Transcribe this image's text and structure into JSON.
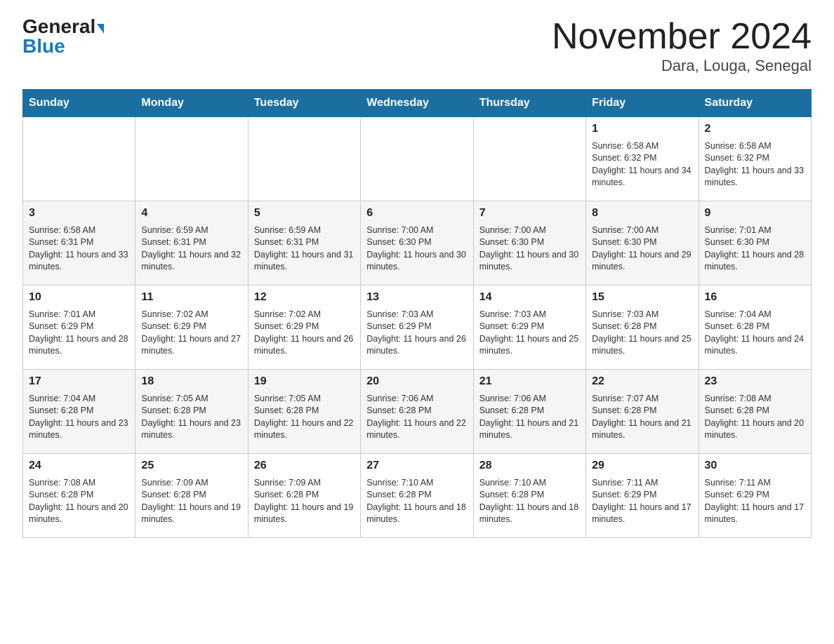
{
  "header": {
    "logo_general": "General",
    "logo_blue": "Blue",
    "title": "November 2024",
    "subtitle": "Dara, Louga, Senegal"
  },
  "weekdays": [
    "Sunday",
    "Monday",
    "Tuesday",
    "Wednesday",
    "Thursday",
    "Friday",
    "Saturday"
  ],
  "weeks": [
    {
      "days": [
        {
          "num": "",
          "sunrise": "",
          "sunset": "",
          "daylight": ""
        },
        {
          "num": "",
          "sunrise": "",
          "sunset": "",
          "daylight": ""
        },
        {
          "num": "",
          "sunrise": "",
          "sunset": "",
          "daylight": ""
        },
        {
          "num": "",
          "sunrise": "",
          "sunset": "",
          "daylight": ""
        },
        {
          "num": "",
          "sunrise": "",
          "sunset": "",
          "daylight": ""
        },
        {
          "num": "1",
          "sunrise": "Sunrise: 6:58 AM",
          "sunset": "Sunset: 6:32 PM",
          "daylight": "Daylight: 11 hours and 34 minutes."
        },
        {
          "num": "2",
          "sunrise": "Sunrise: 6:58 AM",
          "sunset": "Sunset: 6:32 PM",
          "daylight": "Daylight: 11 hours and 33 minutes."
        }
      ]
    },
    {
      "days": [
        {
          "num": "3",
          "sunrise": "Sunrise: 6:58 AM",
          "sunset": "Sunset: 6:31 PM",
          "daylight": "Daylight: 11 hours and 33 minutes."
        },
        {
          "num": "4",
          "sunrise": "Sunrise: 6:59 AM",
          "sunset": "Sunset: 6:31 PM",
          "daylight": "Daylight: 11 hours and 32 minutes."
        },
        {
          "num": "5",
          "sunrise": "Sunrise: 6:59 AM",
          "sunset": "Sunset: 6:31 PM",
          "daylight": "Daylight: 11 hours and 31 minutes."
        },
        {
          "num": "6",
          "sunrise": "Sunrise: 7:00 AM",
          "sunset": "Sunset: 6:30 PM",
          "daylight": "Daylight: 11 hours and 30 minutes."
        },
        {
          "num": "7",
          "sunrise": "Sunrise: 7:00 AM",
          "sunset": "Sunset: 6:30 PM",
          "daylight": "Daylight: 11 hours and 30 minutes."
        },
        {
          "num": "8",
          "sunrise": "Sunrise: 7:00 AM",
          "sunset": "Sunset: 6:30 PM",
          "daylight": "Daylight: 11 hours and 29 minutes."
        },
        {
          "num": "9",
          "sunrise": "Sunrise: 7:01 AM",
          "sunset": "Sunset: 6:30 PM",
          "daylight": "Daylight: 11 hours and 28 minutes."
        }
      ]
    },
    {
      "days": [
        {
          "num": "10",
          "sunrise": "Sunrise: 7:01 AM",
          "sunset": "Sunset: 6:29 PM",
          "daylight": "Daylight: 11 hours and 28 minutes."
        },
        {
          "num": "11",
          "sunrise": "Sunrise: 7:02 AM",
          "sunset": "Sunset: 6:29 PM",
          "daylight": "Daylight: 11 hours and 27 minutes."
        },
        {
          "num": "12",
          "sunrise": "Sunrise: 7:02 AM",
          "sunset": "Sunset: 6:29 PM",
          "daylight": "Daylight: 11 hours and 26 minutes."
        },
        {
          "num": "13",
          "sunrise": "Sunrise: 7:03 AM",
          "sunset": "Sunset: 6:29 PM",
          "daylight": "Daylight: 11 hours and 26 minutes."
        },
        {
          "num": "14",
          "sunrise": "Sunrise: 7:03 AM",
          "sunset": "Sunset: 6:29 PM",
          "daylight": "Daylight: 11 hours and 25 minutes."
        },
        {
          "num": "15",
          "sunrise": "Sunrise: 7:03 AM",
          "sunset": "Sunset: 6:28 PM",
          "daylight": "Daylight: 11 hours and 25 minutes."
        },
        {
          "num": "16",
          "sunrise": "Sunrise: 7:04 AM",
          "sunset": "Sunset: 6:28 PM",
          "daylight": "Daylight: 11 hours and 24 minutes."
        }
      ]
    },
    {
      "days": [
        {
          "num": "17",
          "sunrise": "Sunrise: 7:04 AM",
          "sunset": "Sunset: 6:28 PM",
          "daylight": "Daylight: 11 hours and 23 minutes."
        },
        {
          "num": "18",
          "sunrise": "Sunrise: 7:05 AM",
          "sunset": "Sunset: 6:28 PM",
          "daylight": "Daylight: 11 hours and 23 minutes."
        },
        {
          "num": "19",
          "sunrise": "Sunrise: 7:05 AM",
          "sunset": "Sunset: 6:28 PM",
          "daylight": "Daylight: 11 hours and 22 minutes."
        },
        {
          "num": "20",
          "sunrise": "Sunrise: 7:06 AM",
          "sunset": "Sunset: 6:28 PM",
          "daylight": "Daylight: 11 hours and 22 minutes."
        },
        {
          "num": "21",
          "sunrise": "Sunrise: 7:06 AM",
          "sunset": "Sunset: 6:28 PM",
          "daylight": "Daylight: 11 hours and 21 minutes."
        },
        {
          "num": "22",
          "sunrise": "Sunrise: 7:07 AM",
          "sunset": "Sunset: 6:28 PM",
          "daylight": "Daylight: 11 hours and 21 minutes."
        },
        {
          "num": "23",
          "sunrise": "Sunrise: 7:08 AM",
          "sunset": "Sunset: 6:28 PM",
          "daylight": "Daylight: 11 hours and 20 minutes."
        }
      ]
    },
    {
      "days": [
        {
          "num": "24",
          "sunrise": "Sunrise: 7:08 AM",
          "sunset": "Sunset: 6:28 PM",
          "daylight": "Daylight: 11 hours and 20 minutes."
        },
        {
          "num": "25",
          "sunrise": "Sunrise: 7:09 AM",
          "sunset": "Sunset: 6:28 PM",
          "daylight": "Daylight: 11 hours and 19 minutes."
        },
        {
          "num": "26",
          "sunrise": "Sunrise: 7:09 AM",
          "sunset": "Sunset: 6:28 PM",
          "daylight": "Daylight: 11 hours and 19 minutes."
        },
        {
          "num": "27",
          "sunrise": "Sunrise: 7:10 AM",
          "sunset": "Sunset: 6:28 PM",
          "daylight": "Daylight: 11 hours and 18 minutes."
        },
        {
          "num": "28",
          "sunrise": "Sunrise: 7:10 AM",
          "sunset": "Sunset: 6:28 PM",
          "daylight": "Daylight: 11 hours and 18 minutes."
        },
        {
          "num": "29",
          "sunrise": "Sunrise: 7:11 AM",
          "sunset": "Sunset: 6:29 PM",
          "daylight": "Daylight: 11 hours and 17 minutes."
        },
        {
          "num": "30",
          "sunrise": "Sunrise: 7:11 AM",
          "sunset": "Sunset: 6:29 PM",
          "daylight": "Daylight: 11 hours and 17 minutes."
        }
      ]
    }
  ]
}
